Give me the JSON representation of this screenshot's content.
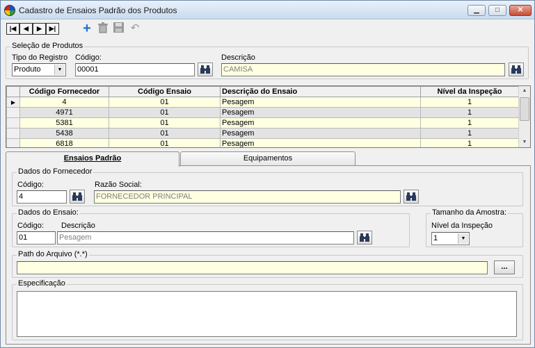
{
  "window": {
    "title": "Cadastro de Ensaios Padrão dos Produtos",
    "minimize": "▁",
    "maximize": "□",
    "close": "✕"
  },
  "toolbar": {
    "nav": [
      "|◀",
      "◀",
      "▶",
      "▶|"
    ],
    "icons": [
      "add-icon",
      "trash-icon",
      "save-icon",
      "undo-icon"
    ]
  },
  "selecao": {
    "legend": "Seleção de Produtos",
    "tipo_label": "Tipo do Registro",
    "tipo_value": "Produto",
    "codigo_label": "Código:",
    "codigo_value": "00001",
    "descricao_label": "Descrição",
    "descricao_value": "CAMISA"
  },
  "grid": {
    "columns": [
      "Código Fornecedor",
      "Código Ensaio",
      "Descrição do Ensaio",
      "Nível da Inspeção"
    ],
    "rows": [
      {
        "fornecedor": "4",
        "ensaio": "01",
        "descricao": "Pesagem",
        "nivel": "1",
        "current": true
      },
      {
        "fornecedor": "4971",
        "ensaio": "01",
        "descricao": "Pesagem",
        "nivel": "1"
      },
      {
        "fornecedor": "5381",
        "ensaio": "01",
        "descricao": "Pesagem",
        "nivel": "1"
      },
      {
        "fornecedor": "5438",
        "ensaio": "01",
        "descricao": "Pesagem",
        "nivel": "1"
      },
      {
        "fornecedor": "6818",
        "ensaio": "01",
        "descricao": "Pesagem",
        "nivel": "1"
      }
    ]
  },
  "tabs": [
    {
      "label": "Ensaios Padrão",
      "active": true
    },
    {
      "label": "Equipamentos",
      "active": false
    }
  ],
  "fornecedor": {
    "legend": "Dados do Fornecedor",
    "codigo_label": "Código:",
    "codigo_value": "4",
    "razao_label": "Razão Social:",
    "razao_value": "FORNECEDOR PRINCIPAL"
  },
  "ensaio": {
    "legend": "Dados do Ensaio:",
    "codigo_label": "Código:",
    "codigo_value": "01",
    "descricao_label": "Descrição",
    "descricao_value": "Pesagem"
  },
  "amostra": {
    "legend": "Tamanho da Amostra:",
    "nivel_label": "Nível da Inspeção",
    "nivel_value": "1"
  },
  "path": {
    "legend": "Path do Arquivo (*.*)",
    "value": "",
    "browse_label": "..."
  },
  "especificacao": {
    "legend": "Especificação",
    "value": ""
  }
}
